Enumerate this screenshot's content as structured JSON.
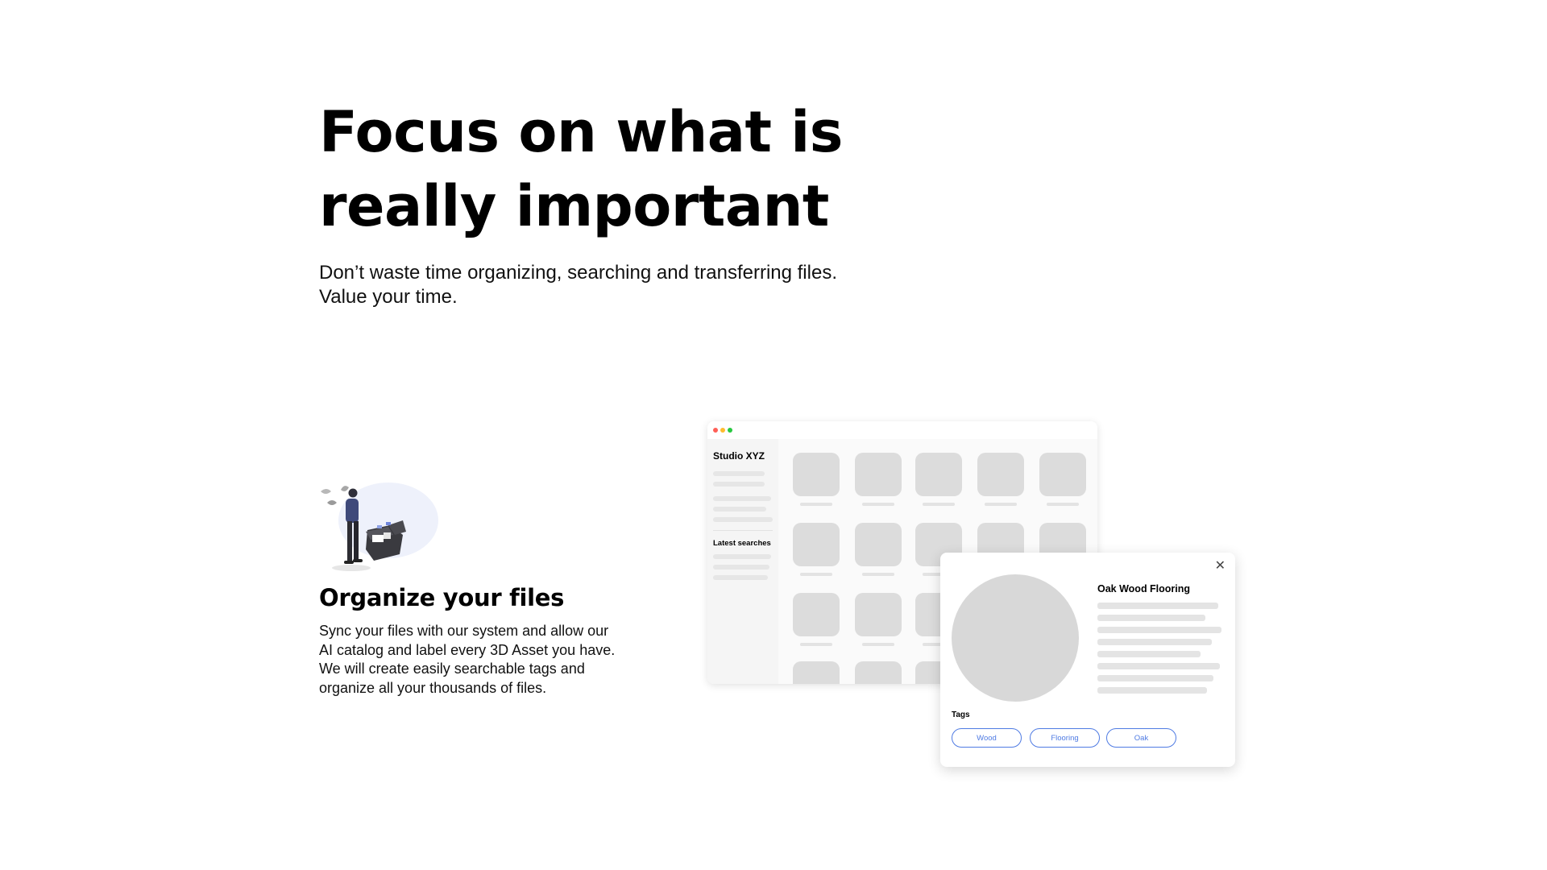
{
  "hero": {
    "title_line1": "Focus on what is",
    "title_line2": "really important",
    "subtitle_line1": "Don’t waste time organizing, searching and transferring files.",
    "subtitle_line2": "Value your time."
  },
  "feature": {
    "title": "Organize your files",
    "description": "Sync your files with our system and allow our AI catalog and label every 3D Asset you have. We will create easily searchable tags and organize all your thousands of files."
  },
  "app_mockup": {
    "window_controls": [
      "close",
      "minimize",
      "maximize"
    ],
    "colors": {
      "close": "#ff5f57",
      "minimize": "#febc2e",
      "maximize": "#28c840"
    },
    "sidebar_title": "Studio XYZ",
    "latest_searches_label": "Latest searches"
  },
  "detail_panel": {
    "title": "Oak Wood Flooring",
    "tags_label": "Tags",
    "tags": [
      "Wood",
      "Flooring",
      "Oak"
    ],
    "accent_color": "#4f7be3",
    "close_icon": "close-icon"
  }
}
